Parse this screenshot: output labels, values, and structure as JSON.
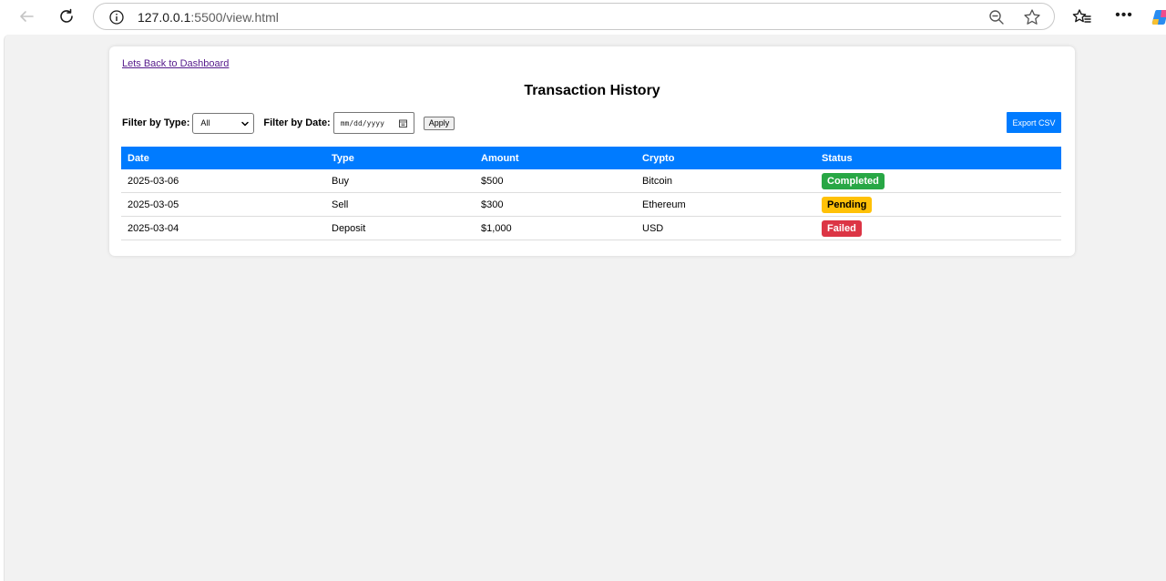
{
  "browser": {
    "url_host": "127.0.0.1",
    "url_path": ":5500/view.html"
  },
  "page": {
    "back_link": "Lets Back to Dashboard",
    "title": "Transaction History",
    "filters": {
      "type_label": "Filter by Type:",
      "type_value": "All",
      "date_label": "Filter by Date:",
      "date_placeholder": "mm/dd/yyyy",
      "apply_label": "Apply"
    },
    "export_label": "Export CSV"
  },
  "table": {
    "columns": [
      "Date",
      "Type",
      "Amount",
      "Crypto",
      "Status"
    ],
    "rows": [
      {
        "date": "2025-03-06",
        "type": "Buy",
        "amount": "$500",
        "crypto": "Bitcoin",
        "status": "Completed"
      },
      {
        "date": "2025-03-05",
        "type": "Sell",
        "amount": "$300",
        "crypto": "Ethereum",
        "status": "Pending"
      },
      {
        "date": "2025-03-04",
        "type": "Deposit",
        "amount": "$1,000",
        "crypto": "USD",
        "status": "Failed"
      }
    ]
  },
  "colors": {
    "accent": "#007bff",
    "completed": "#28a745",
    "pending": "#ffc107",
    "failed": "#dc3545",
    "page_bg": "#f2f2f2"
  },
  "icons": [
    "back-arrow-icon",
    "reload-icon",
    "info-icon",
    "zoom-out-icon",
    "star-icon",
    "favorites-icon",
    "more-icon",
    "copilot-icon",
    "chevron-down-icon",
    "calendar-icon"
  ]
}
